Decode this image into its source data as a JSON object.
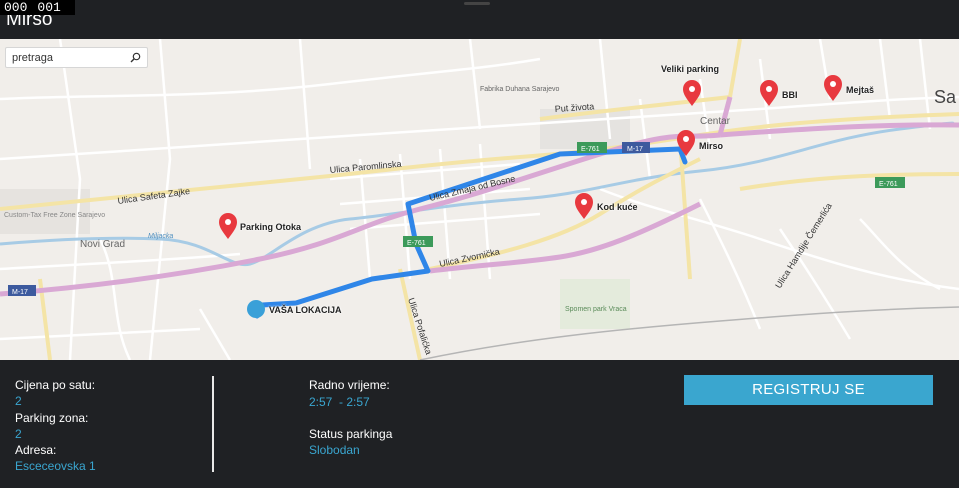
{
  "debug": {
    "counter_a": "000",
    "counter_b": "001"
  },
  "app": {
    "title": "Mirso"
  },
  "search": {
    "placeholder": "pretraga",
    "value": ""
  },
  "map": {
    "street_labels": [
      "Ulica Safeta Zajke",
      "Ulica Paromlinska",
      "Ulica Zmaja od Bosne",
      "Ulica Zvornička",
      "Ulica Pofalićka",
      "Put života",
      "Ulica Hamdije Čemerlića"
    ],
    "area_labels": [
      "Novi Grad",
      "Fabrika Duhana Sarajevo",
      "Centar",
      "Spomen park Vraca",
      "Miljacka",
      "Custom-Tax Free Zone Sarajevo",
      "Sa"
    ],
    "road_shields": [
      "E-761",
      "M-17",
      "E-761",
      "E-761",
      "M-17"
    ],
    "pins": [
      {
        "label": "Veliki parking"
      },
      {
        "label": "BBI"
      },
      {
        "label": "Mejtaš"
      },
      {
        "label": "Mirso"
      },
      {
        "label": "Kod kuće"
      },
      {
        "label": "Parking Otoka"
      }
    ],
    "location": {
      "label": "VAŠA LOKACIJA"
    },
    "colors": {
      "route": "#2f86e8",
      "pin": "#e8393f",
      "location": "#3aa0d8"
    }
  },
  "details": {
    "price_label": "Cijena po satu:",
    "price_value": "2",
    "zone_label": "Parking zona:",
    "zone_value": "2",
    "address_label": "Adresa:",
    "address_value": "Esceceovska 1",
    "hours_label": "Radno vrijeme:",
    "hours_value": "2:57  - 2:57",
    "status_label": "Status parkinga",
    "status_value": "Slobodan"
  },
  "actions": {
    "register_label": "REGISTRUJ SE"
  },
  "colors": {
    "background": "#1f2124",
    "accent": "#3aa6cf"
  }
}
